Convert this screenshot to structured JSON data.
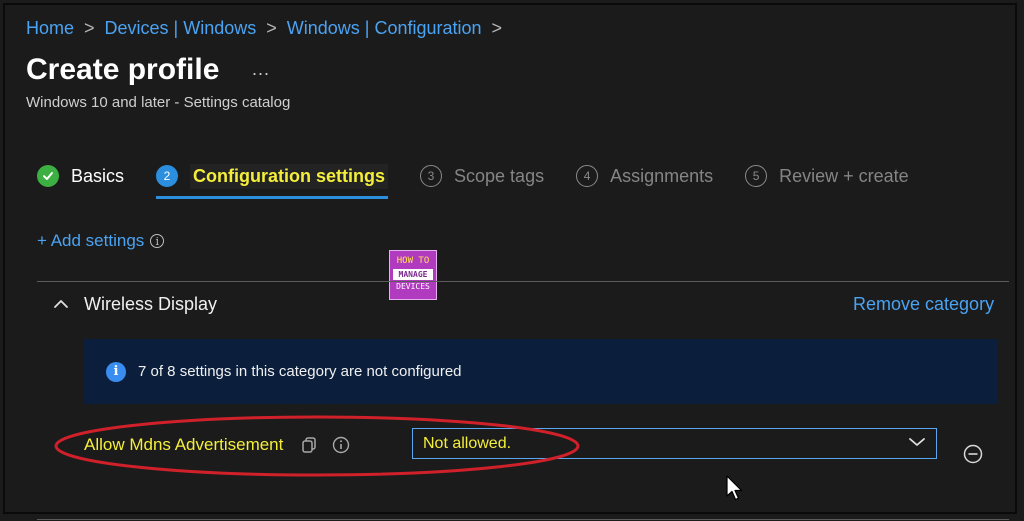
{
  "breadcrumb": {
    "items": [
      "Home",
      "Devices | Windows",
      "Windows | Configuration"
    ],
    "separator": ">"
  },
  "header": {
    "title": "Create profile",
    "more": "...",
    "subtitle": "Windows 10 and later - Settings catalog"
  },
  "wizard": {
    "steps": [
      {
        "number": "",
        "label": "Basics",
        "state": "done"
      },
      {
        "number": "2",
        "label": "Configuration settings",
        "state": "current"
      },
      {
        "number": "3",
        "label": "Scope tags",
        "state": "todo"
      },
      {
        "number": "4",
        "label": "Assignments",
        "state": "todo"
      },
      {
        "number": "5",
        "label": "Review + create",
        "state": "todo"
      }
    ]
  },
  "actions": {
    "add_settings": "+ Add settings"
  },
  "watermark": {
    "line1": "HOW TO",
    "line2": "MANAGE",
    "line3": "DEVICES"
  },
  "category": {
    "title": "Wireless Display",
    "remove_label": "Remove category",
    "info_text": "7 of 8 settings in this category are not configured"
  },
  "setting": {
    "label": "Allow Mdns Advertisement",
    "value": "Not allowed."
  },
  "colors": {
    "accent": "#4aa3f3",
    "highlight": "#f4ee3a",
    "success": "#3cb043",
    "annotation": "#d0202a",
    "banner": "#0b1f3d"
  },
  "icons": {
    "step_done": "checkmark-icon",
    "info": "info-icon",
    "collapse": "chevron-up-icon",
    "copy": "copy-icon",
    "dropdown": "chevron-down-icon",
    "remove": "minus-circle-icon"
  }
}
